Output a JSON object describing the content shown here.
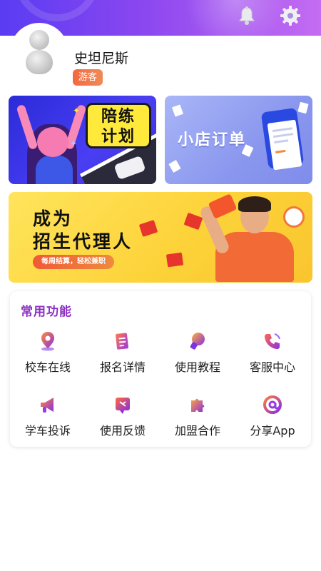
{
  "header": {
    "bell_icon": "bell-icon",
    "settings_icon": "gear-icon",
    "gradient": [
      "#5a3cf2",
      "#8b47f0",
      "#c46cf2"
    ]
  },
  "profile": {
    "name": "史坦尼斯",
    "badge": "游客",
    "badge_color": "#f3693f"
  },
  "banners": {
    "practice": {
      "title_line1": "陪练",
      "title_line2": "计划"
    },
    "order": {
      "title": "小店订单"
    },
    "agent": {
      "title_line1": "成为",
      "title_line2": "招生代理人",
      "tagline": "每周结算，轻松兼职"
    }
  },
  "functions": {
    "title": "常用功能",
    "title_color": "#8b2fc2",
    "items": [
      {
        "label": "校车在线",
        "icon": "location-pin-icon"
      },
      {
        "label": "报名详情",
        "icon": "document-icon"
      },
      {
        "label": "使用教程",
        "icon": "lightbulb-icon"
      },
      {
        "label": "客服中心",
        "icon": "phone-icon"
      },
      {
        "label": "学车投诉",
        "icon": "megaphone-icon"
      },
      {
        "label": "使用反馈",
        "icon": "feedback-icon"
      },
      {
        "label": "加盟合作",
        "icon": "puzzle-icon"
      },
      {
        "label": "分享App",
        "icon": "at-sign-icon"
      }
    ]
  }
}
